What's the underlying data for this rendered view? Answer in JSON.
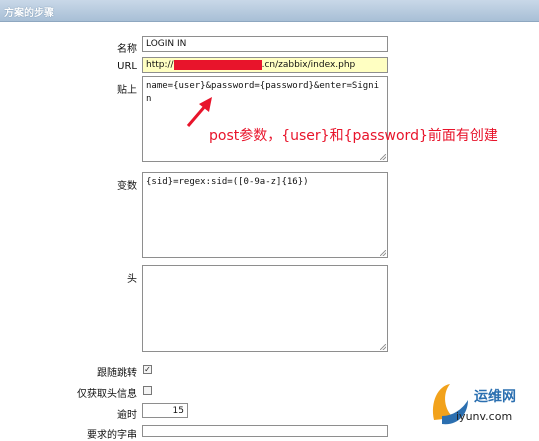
{
  "header": {
    "title": "方案的步骤"
  },
  "fields": {
    "name": {
      "label": "名称",
      "value": "LOGIN IN"
    },
    "url": {
      "label": "URL",
      "prefix": "http://",
      "suffix": ".cn/zabbix/index.php"
    },
    "post": {
      "label": "贴上",
      "value": "name={user}&password={password}&enter=Signin"
    },
    "variables": {
      "label": "变数",
      "value": "{sid}=regex:sid=([0-9a-z]{16})"
    },
    "headers": {
      "label": "头",
      "value": ""
    },
    "follow_redirects": {
      "label": "跟随跳转",
      "checked": true
    },
    "retrieve_headers": {
      "label": "仅获取头信息",
      "checked": false
    },
    "timeout": {
      "label": "逾时",
      "value": "15"
    },
    "required_string": {
      "label": "要求的字串"
    }
  },
  "annotation": {
    "text": "post参数，{user}和{password}前面有创建"
  },
  "watermark": {
    "top": "运维网",
    "bottom": "iyunv.com"
  },
  "colors": {
    "annotation": "#e8142b",
    "redaction": "#e8142b",
    "url_bg": "#ffffc2"
  }
}
